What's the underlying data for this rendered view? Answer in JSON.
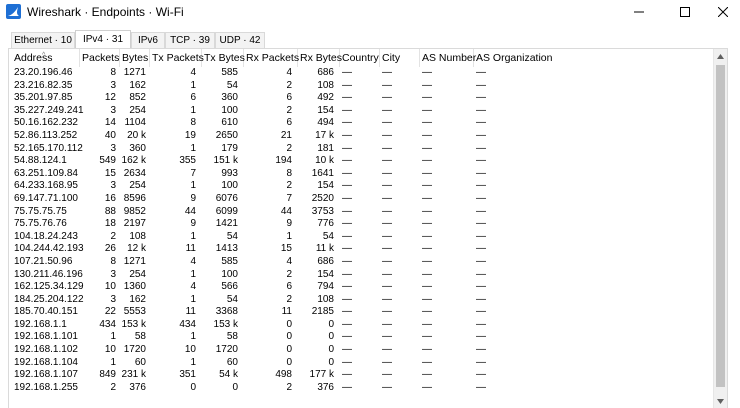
{
  "window": {
    "title": "Wireshark · Endpoints · Wi-Fi",
    "icons": {
      "app": "wireshark-fin-icon",
      "minimize": "minimize-icon",
      "maximize": "maximize-icon",
      "close": "close-icon"
    },
    "accent": "#1e6fd4"
  },
  "tabs": [
    {
      "label": "Ethernet · 10",
      "active": false
    },
    {
      "label": "IPv4 · 31",
      "active": true
    },
    {
      "label": "IPv6",
      "active": false
    },
    {
      "label": "TCP · 39",
      "active": false
    },
    {
      "label": "UDP · 42",
      "active": false
    }
  ],
  "table": {
    "columns": [
      "Address",
      "Packets",
      "Bytes",
      "Tx Packets",
      "Tx Bytes",
      "Rx Packets",
      "Rx Bytes",
      "Country",
      "City",
      "AS Number",
      "AS Organization"
    ],
    "sorted_column": "Address",
    "rows": [
      [
        "23.20.196.46",
        "8",
        "1271",
        "4",
        "585",
        "4",
        "686",
        "—",
        "—",
        "—",
        "—"
      ],
      [
        "23.216.82.35",
        "3",
        "162",
        "1",
        "54",
        "2",
        "108",
        "—",
        "—",
        "—",
        "—"
      ],
      [
        "35.201.97.85",
        "12",
        "852",
        "6",
        "360",
        "6",
        "492",
        "—",
        "—",
        "—",
        "—"
      ],
      [
        "35.227.249.241",
        "3",
        "254",
        "1",
        "100",
        "2",
        "154",
        "—",
        "—",
        "—",
        "—"
      ],
      [
        "50.16.162.232",
        "14",
        "1104",
        "8",
        "610",
        "6",
        "494",
        "—",
        "—",
        "—",
        "—"
      ],
      [
        "52.86.113.252",
        "40",
        "20 k",
        "19",
        "2650",
        "21",
        "17 k",
        "—",
        "—",
        "—",
        "—"
      ],
      [
        "52.165.170.112",
        "3",
        "360",
        "1",
        "179",
        "2",
        "181",
        "—",
        "—",
        "—",
        "—"
      ],
      [
        "54.88.124.1",
        "549",
        "162 k",
        "355",
        "151 k",
        "194",
        "10 k",
        "—",
        "—",
        "—",
        "—"
      ],
      [
        "63.251.109.84",
        "15",
        "2634",
        "7",
        "993",
        "8",
        "1641",
        "—",
        "—",
        "—",
        "—"
      ],
      [
        "64.233.168.95",
        "3",
        "254",
        "1",
        "100",
        "2",
        "154",
        "—",
        "—",
        "—",
        "—"
      ],
      [
        "69.147.71.100",
        "16",
        "8596",
        "9",
        "6076",
        "7",
        "2520",
        "—",
        "—",
        "—",
        "—"
      ],
      [
        "75.75.75.75",
        "88",
        "9852",
        "44",
        "6099",
        "44",
        "3753",
        "—",
        "—",
        "—",
        "—"
      ],
      [
        "75.75.76.76",
        "18",
        "2197",
        "9",
        "1421",
        "9",
        "776",
        "—",
        "—",
        "—",
        "—"
      ],
      [
        "104.18.24.243",
        "2",
        "108",
        "1",
        "54",
        "1",
        "54",
        "—",
        "—",
        "—",
        "—"
      ],
      [
        "104.244.42.193",
        "26",
        "12 k",
        "11",
        "1413",
        "15",
        "11 k",
        "—",
        "—",
        "—",
        "—"
      ],
      [
        "107.21.50.96",
        "8",
        "1271",
        "4",
        "585",
        "4",
        "686",
        "—",
        "—",
        "—",
        "—"
      ],
      [
        "130.211.46.196",
        "3",
        "254",
        "1",
        "100",
        "2",
        "154",
        "—",
        "—",
        "—",
        "—"
      ],
      [
        "162.125.34.129",
        "10",
        "1360",
        "4",
        "566",
        "6",
        "794",
        "—",
        "—",
        "—",
        "—"
      ],
      [
        "184.25.204.122",
        "3",
        "162",
        "1",
        "54",
        "2",
        "108",
        "—",
        "—",
        "—",
        "—"
      ],
      [
        "185.70.40.151",
        "22",
        "5553",
        "11",
        "3368",
        "11",
        "2185",
        "—",
        "—",
        "—",
        "—"
      ],
      [
        "192.168.1.1",
        "434",
        "153 k",
        "434",
        "153 k",
        "0",
        "0",
        "—",
        "—",
        "—",
        "—"
      ],
      [
        "192.168.1.101",
        "1",
        "58",
        "1",
        "58",
        "0",
        "0",
        "—",
        "—",
        "—",
        "—"
      ],
      [
        "192.168.1.102",
        "10",
        "1720",
        "10",
        "1720",
        "0",
        "0",
        "—",
        "—",
        "—",
        "—"
      ],
      [
        "192.168.1.104",
        "1",
        "60",
        "1",
        "60",
        "0",
        "0",
        "—",
        "—",
        "—",
        "—"
      ],
      [
        "192.168.1.107",
        "849",
        "231 k",
        "351",
        "54 k",
        "498",
        "177 k",
        "—",
        "—",
        "—",
        "—"
      ],
      [
        "192.168.1.255",
        "2",
        "376",
        "0",
        "0",
        "2",
        "376",
        "—",
        "—",
        "—",
        "—"
      ]
    ]
  }
}
